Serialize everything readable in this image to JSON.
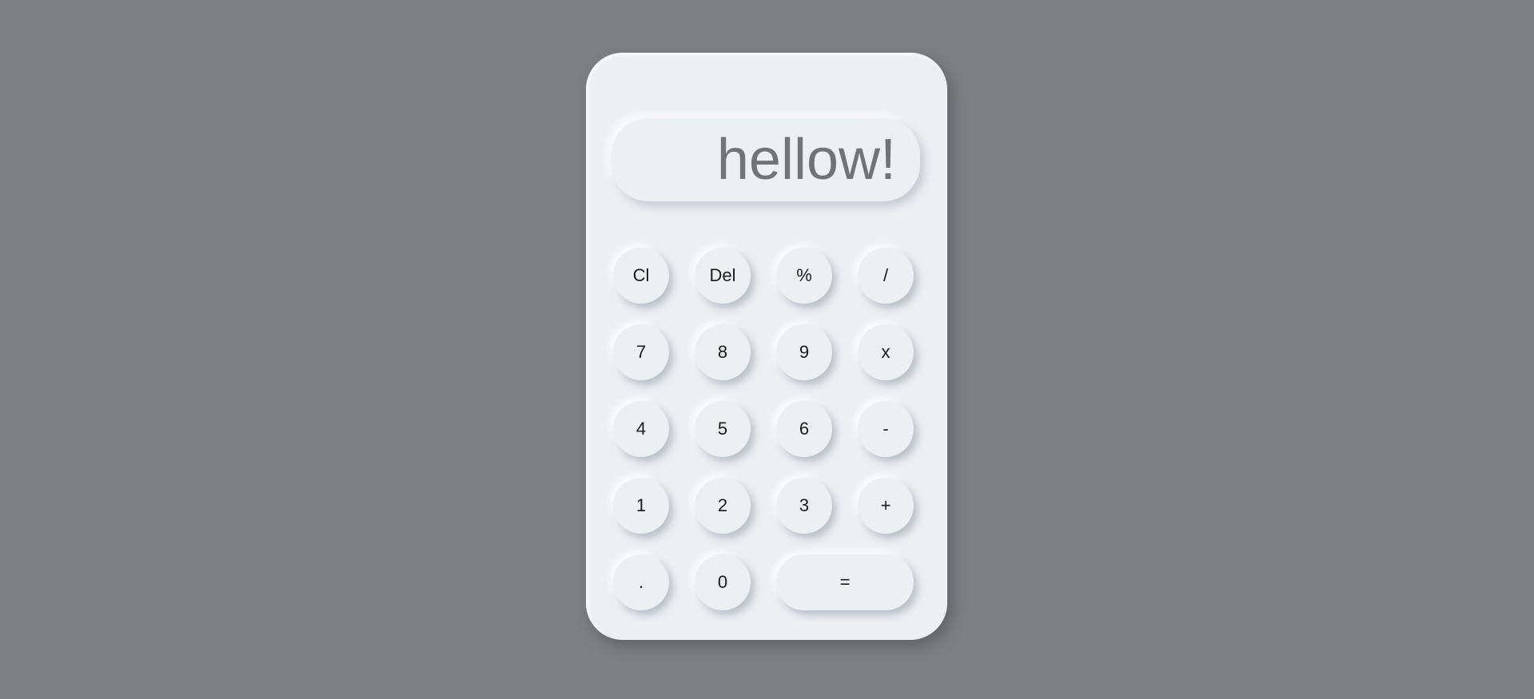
{
  "display": {
    "text": "hellow!"
  },
  "keys": {
    "row1": [
      "Cl",
      "Del",
      "%",
      "/"
    ],
    "row2": [
      "7",
      "8",
      "9",
      "x"
    ],
    "row3": [
      "4",
      "5",
      "6",
      "-"
    ],
    "row4": [
      "1",
      "2",
      "3",
      "+"
    ],
    "row5": [
      ".",
      "0",
      "="
    ]
  }
}
